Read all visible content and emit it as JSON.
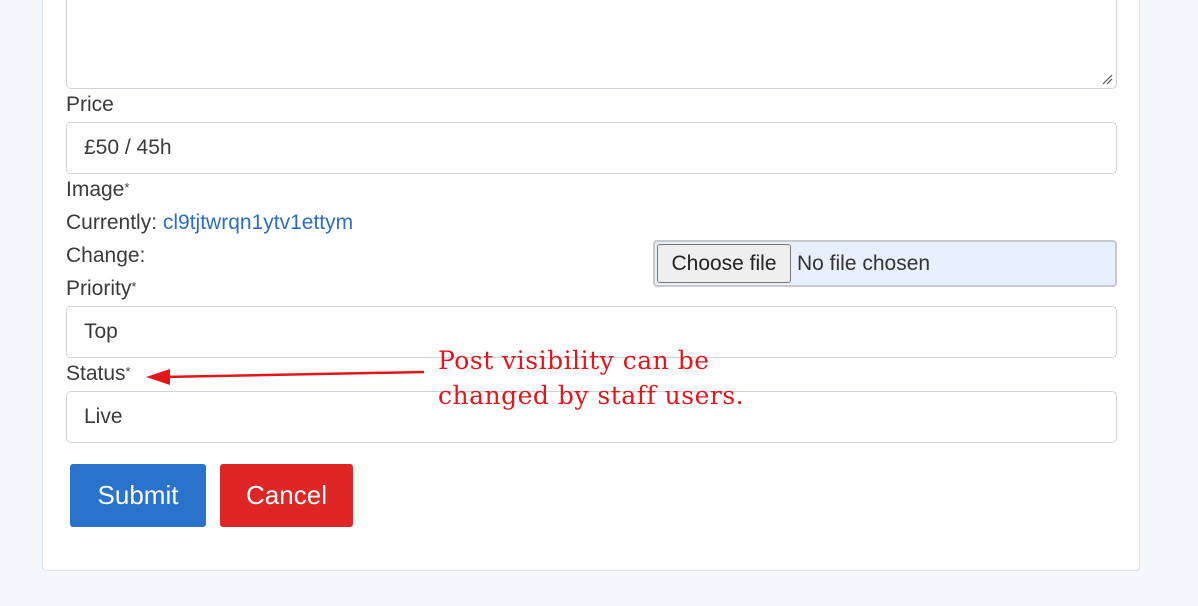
{
  "form": {
    "price_label": "Price",
    "price_value": "£50 / 45h",
    "image_label": "Image",
    "image_required_mark": "*",
    "currently_label": "Currently:",
    "currently_link": "cl9tjtwrqn1ytv1ettym",
    "change_label": "Change:",
    "file_button_label": "Choose file",
    "file_status": "No file chosen",
    "priority_label": "Priority",
    "priority_required_mark": "*",
    "priority_value": "Top",
    "status_label": "Status",
    "status_required_mark": "*",
    "status_value": "Live",
    "submit_label": "Submit",
    "cancel_label": "Cancel"
  },
  "annotation": {
    "line1": "Post visibility can be",
    "line2": "changed by staff users."
  },
  "colors": {
    "primary": "#2a73cc",
    "danger": "#de2626",
    "annotation": "#e3161b",
    "link": "#2b6fc2"
  },
  "icons": {
    "resize": "resize-handle-icon",
    "arrow": "arrow-left-icon"
  }
}
